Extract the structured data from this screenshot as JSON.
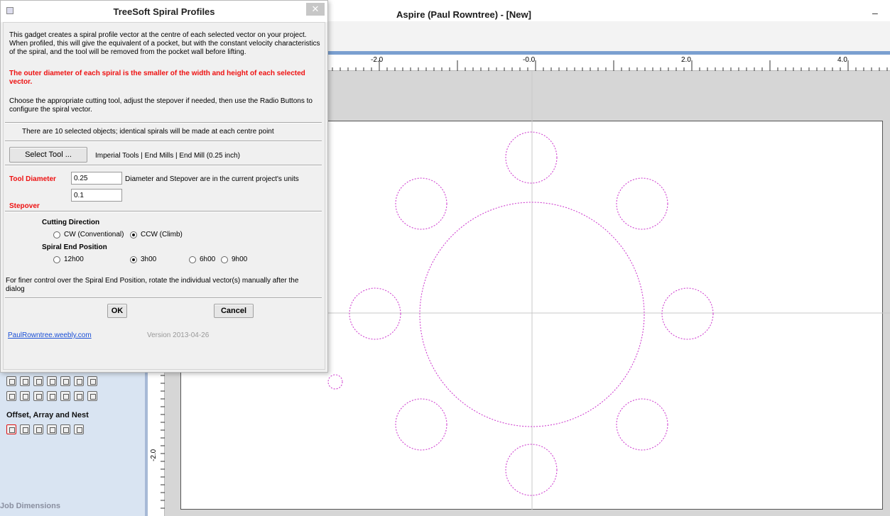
{
  "aspire": {
    "title": "Aspire (Paul Rowntree) - [New]",
    "minimize_glyph": "–",
    "ruler_labels": [
      "-2.0",
      "-0.0",
      "2.0",
      "4.0"
    ],
    "vertical_ruler_label": "-2.0",
    "panel_heading": "Offset, Array and Nest",
    "job_dimensions": "Job Dimensions",
    "vector_color": "#cc33cc"
  },
  "dialog": {
    "title": "TreeSoft Spiral Profiles",
    "close_glyph": "✕",
    "intro": "This gadget creates a spiral profile vector at the centre of each selected vector on your project.  When profiled, this will give the equivalent of a pocket, but with the constant velocity characteristics of the spiral, and the tool will be removed from the pocket wall before lifting.",
    "warning": "The outer diameter of each spiral is the smaller of the width and height of each selected vector.",
    "instructions": "Choose the appropriate cutting tool, adjust the stepover if needed, then use the Radio Buttons to configure the spiral vector.",
    "selection_info": "There are 10 selected objects; identical spirals will be made at each centre point",
    "select_tool_label": "Select Tool ...",
    "tool_path": "Imperial Tools | End Mills | End Mill (0.25 inch)",
    "tool_diameter_label": "Tool Diameter",
    "tool_diameter_value": "0.25",
    "units_note": "Diameter and Stepover are in the current project's units",
    "stepover_label": "Stepover",
    "stepover_value": "0.1",
    "cutting_direction_heading": "Cutting Direction",
    "cutting_direction_options": [
      {
        "label": "CW (Conventional)",
        "selected": false
      },
      {
        "label": "CCW (Climb)",
        "selected": true
      }
    ],
    "end_position_heading": "Spiral End Position",
    "end_position_options": [
      {
        "label": "12h00",
        "selected": false
      },
      {
        "label": "3h00",
        "selected": true
      },
      {
        "label": "6h00",
        "selected": false
      },
      {
        "label": "9h00",
        "selected": false
      }
    ],
    "finer_control_note": "For finer control over the Spiral End Position, rotate the individual  vector(s) manually after the dialog",
    "ok_label": "OK",
    "cancel_label": "Cancel",
    "website": "PaulRowntree.weebly.com",
    "version": "Version 2013-04-26"
  }
}
